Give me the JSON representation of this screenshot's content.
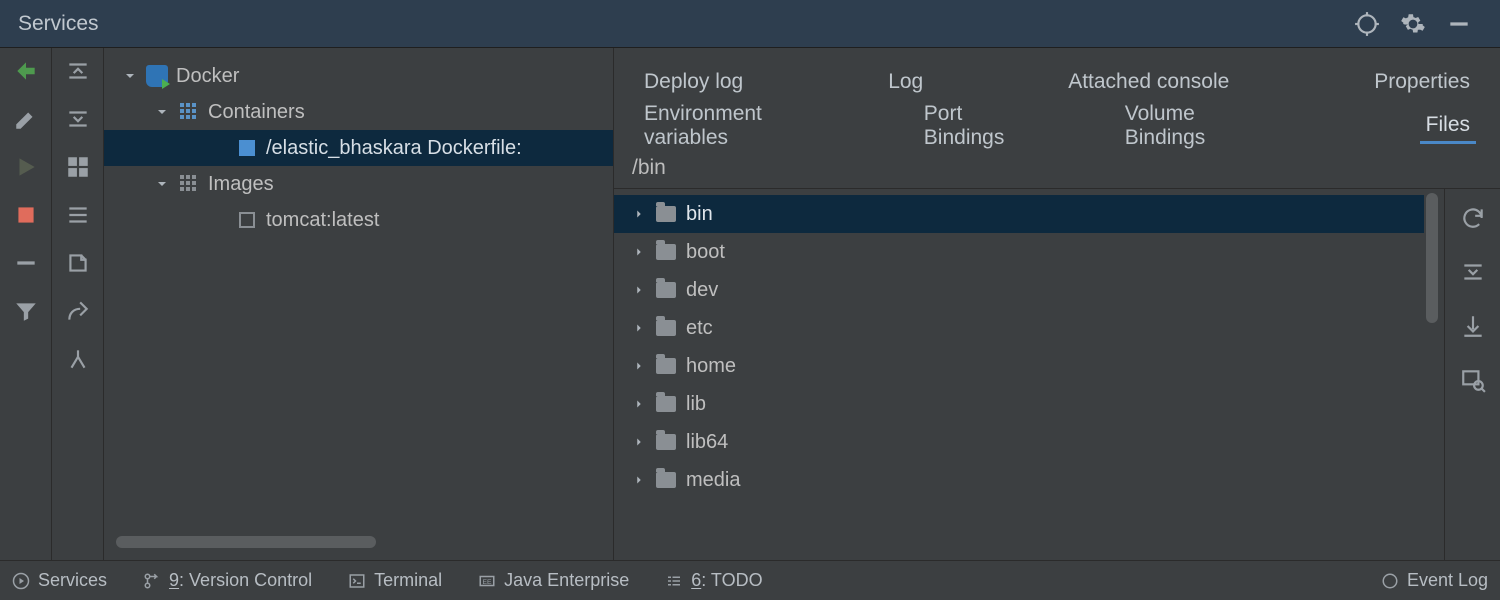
{
  "titlebar": {
    "title": "Services"
  },
  "tree": {
    "root": "Docker",
    "containers_label": "Containers",
    "selected_container": "/elastic_bhaskara Dockerfile:",
    "images_label": "Images",
    "image_0": "tomcat:latest"
  },
  "tabs": {
    "row1": {
      "deploy_log": "Deploy log",
      "log": "Log",
      "attached_console": "Attached console",
      "properties": "Properties"
    },
    "row2": {
      "env": "Environment variables",
      "ports": "Port Bindings",
      "volumes": "Volume Bindings",
      "files": "Files"
    },
    "active": "files"
  },
  "files": {
    "path": "/bin",
    "items": [
      "bin",
      "boot",
      "dev",
      "etc",
      "home",
      "lib",
      "lib64",
      "media"
    ],
    "selected_index": 0
  },
  "status": {
    "services": "Services",
    "vcs_prefix": "9",
    "vcs_rest": ": Version Control",
    "terminal": "Terminal",
    "javaee": "Java Enterprise",
    "todo_prefix": "6",
    "todo_rest": ": TODO",
    "event_log": "Event Log"
  }
}
